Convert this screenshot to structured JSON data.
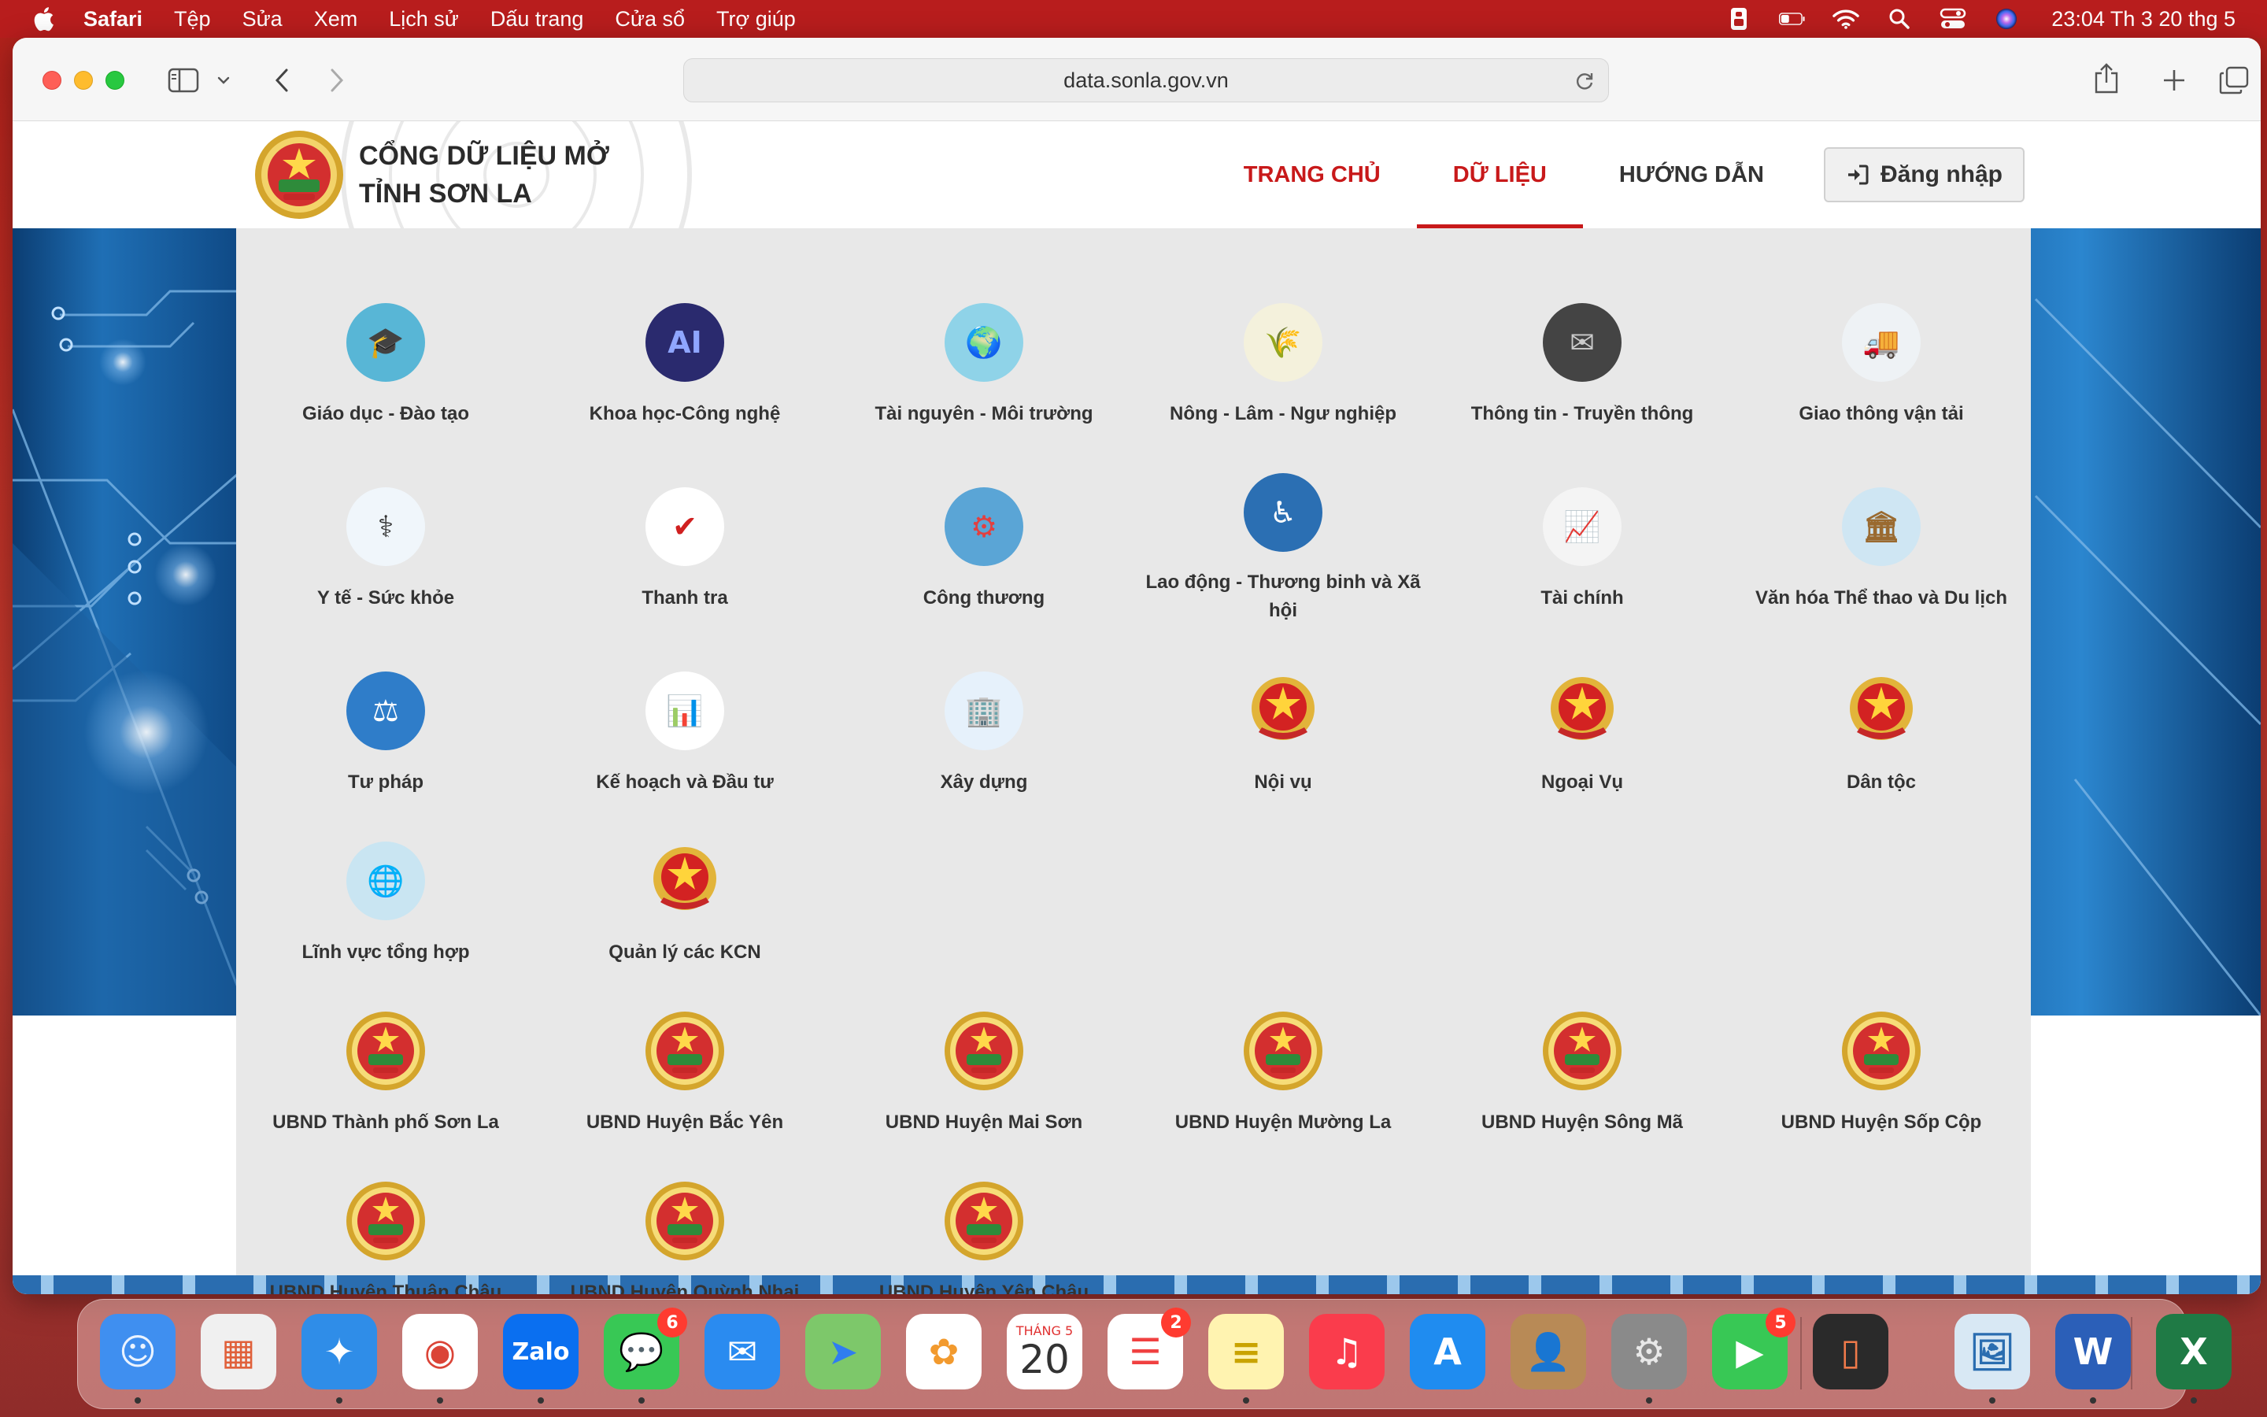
{
  "menubar": {
    "app_name": "Safari",
    "menus": [
      "Tệp",
      "Sửa",
      "Xem",
      "Lịch sử",
      "Dấu trang",
      "Cửa sổ",
      "Trợ giúp"
    ],
    "clock": "23:04 Th 3 20 thg 5",
    "status_icons": [
      "finder-tag-icon",
      "battery-icon",
      "wifi-icon",
      "spotlight-search-icon",
      "control-center-icon",
      "siri-icon"
    ]
  },
  "browser": {
    "url": "data.sonla.gov.vn"
  },
  "site": {
    "title_line1": "CỔNG DỮ LIỆU MỞ",
    "title_line2": "TỈNH SƠN LA",
    "nav": {
      "home": "TRANG CHỦ",
      "data": "DỮ LIỆU",
      "guide": "HƯỚNG DẪN",
      "login": "Đăng nhập"
    },
    "active_nav": "DỮ LIỆU"
  },
  "categories": [
    {
      "label": "Giáo dục - Đào tạo",
      "icon": "education-icon"
    },
    {
      "label": "Khoa học-Công nghệ",
      "icon": "science-technology-icon"
    },
    {
      "label": "Tài nguyên - Môi trường",
      "icon": "environment-icon"
    },
    {
      "label": "Nông - Lâm - Ngư nghiệp",
      "icon": "agriculture-icon"
    },
    {
      "label": "Thông tin - Truyền thông",
      "icon": "communication-icon"
    },
    {
      "label": "Giao thông vận tải",
      "icon": "transport-truck-icon"
    },
    {
      "label": "Y tế - Sức khỏe",
      "icon": "doctor-icon"
    },
    {
      "label": "Thanh tra",
      "icon": "inspection-icon"
    },
    {
      "label": "Công thương",
      "icon": "industry-trade-icon"
    },
    {
      "label": "Lao động - Thương binh và Xã hội",
      "icon": "accessibility-icon"
    },
    {
      "label": "Tài chính",
      "icon": "finance-chart-icon"
    },
    {
      "label": "Văn hóa Thể thao và Du lịch",
      "icon": "culture-tourism-icon"
    },
    {
      "label": "Tư pháp",
      "icon": "justice-icon"
    },
    {
      "label": "Kế hoạch và Đầu tư",
      "icon": "planning-board-icon"
    },
    {
      "label": "Xây dựng",
      "icon": "construction-buildings-icon"
    },
    {
      "label": "Nội vụ",
      "icon": "national-emblem-icon"
    },
    {
      "label": "Ngoại Vụ",
      "icon": "national-emblem-icon"
    },
    {
      "label": "Dân tộc",
      "icon": "national-emblem-icon"
    },
    {
      "label": "Lĩnh vực tổng hợp",
      "icon": "general-globe-icon"
    },
    {
      "label": "Quản lý các KCN",
      "icon": "national-emblem-icon"
    }
  ],
  "districts": [
    {
      "label": "UBND Thành phố Sơn La",
      "icon": "province-emblem-icon"
    },
    {
      "label": "UBND Huyện Bắc Yên",
      "icon": "province-emblem-icon"
    },
    {
      "label": "UBND Huyện Mai Sơn",
      "icon": "province-emblem-icon"
    },
    {
      "label": "UBND Huyện Mường La",
      "icon": "province-emblem-icon"
    },
    {
      "label": "UBND Huyện Sông Mã",
      "icon": "province-emblem-icon"
    },
    {
      "label": "UBND Huyện Sốp Cộp",
      "icon": "province-emblem-icon"
    },
    {
      "label": "UBND Huyện Thuận Châu",
      "icon": "province-emblem-icon"
    },
    {
      "label": "UBND Huyện Quỳnh Nhai",
      "icon": "province-emblem-icon"
    },
    {
      "label": "UBND Huyện Yên Châu",
      "icon": "province-emblem-icon"
    }
  ],
  "dock": {
    "apps": [
      {
        "name": "finder-icon"
      },
      {
        "name": "launchpad-icon"
      },
      {
        "name": "safari-icon"
      },
      {
        "name": "chrome-icon"
      },
      {
        "name": "zalo-icon",
        "text": "Zalo"
      },
      {
        "name": "messages-icon",
        "badge": "6"
      },
      {
        "name": "mail-icon"
      },
      {
        "name": "maps-icon"
      },
      {
        "name": "photos-icon"
      },
      {
        "name": "calendar-icon",
        "month": "THÁNG 5",
        "day": "20"
      },
      {
        "name": "reminders-icon",
        "badge": "2"
      },
      {
        "name": "notes-icon"
      },
      {
        "name": "music-icon"
      },
      {
        "name": "app-store-icon"
      },
      {
        "name": "contacts-icon"
      },
      {
        "name": "system-settings-icon"
      },
      {
        "name": "facetime-icon",
        "badge": "5"
      },
      {
        "name": "iphone-mirroring-icon"
      },
      {
        "name": "preview-icon"
      },
      {
        "name": "word-icon"
      },
      {
        "name": "excel-icon"
      },
      {
        "name": "trash-icon"
      }
    ]
  },
  "colors": {
    "accent_red": "#c8191a",
    "menubar": "#b81d1d",
    "dropdown_bg": "#e8e8e8"
  }
}
